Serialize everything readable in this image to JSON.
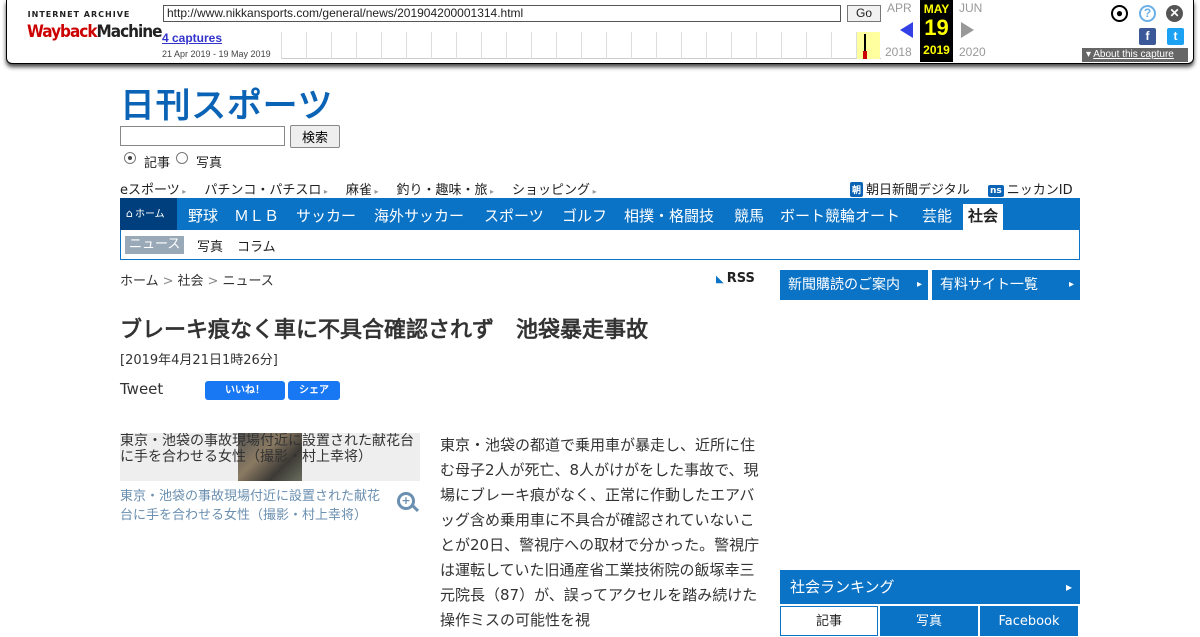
{
  "wayback": {
    "logo_top": "INTERNET ARCHIVE",
    "logo_way": "Wayback",
    "logo_machine": "Machine",
    "url": "http://www.nikkansports.com/general/news/201904200001314.html",
    "go_label": "Go",
    "captures": "4 captures",
    "range": "21 Apr 2019 - 19 May 2019",
    "prev_month": "APR",
    "cur_month": "MAY",
    "next_month": "JUN",
    "cur_day": "19",
    "prev_year": "2018",
    "cur_year": "2019",
    "next_year": "2020",
    "about": "About this capture",
    "icons": [
      "user-icon",
      "help-icon",
      "close-icon",
      "facebook-icon",
      "twitter-icon"
    ]
  },
  "site": {
    "logo": "日刊スポーツ",
    "search_button": "検索",
    "radio_article": "記事",
    "radio_photo": "写真",
    "top_links": [
      "eスポーツ",
      "パチンコ・パチスロ",
      "麻雀",
      "釣り・趣味・旅",
      "ショッピング"
    ],
    "ext_asahi_badge": "朝",
    "ext_asahi": "朝日新聞デジタル",
    "ext_nikkan_badge": "ns",
    "ext_nikkan": "ニッカンID",
    "nav_home": "ホーム",
    "nav": [
      "野球",
      "ＭＬＢ",
      "サッカー",
      "海外サッカー",
      "スポーツ",
      "ゴルフ",
      "相撲・格闘技",
      "競馬",
      "ボート競輪オート",
      "芸能",
      "社会"
    ],
    "subnav": [
      "ニュース",
      "写真",
      "コラム"
    ],
    "accent": "#0b73c6"
  },
  "article": {
    "breadcrumb": [
      "ホーム",
      "社会",
      "ニュース"
    ],
    "crumb_sep": ">",
    "rss": "RSS",
    "title": "ブレーキ痕なく車に不具合確認されず　池袋暴走事故",
    "date": "[2019年4月21日1時26分]",
    "tweet": "Tweet",
    "fb_like": "いいね！",
    "fb_share": "シェア",
    "photo_alt": "東京・池袋の事故現場付近に設置された献花台に手を合わせる女性（撮影・村上幸将）",
    "caption": "東京・池袋の事故現場付近に設置された献花台に手を合わせる女性（撮影・村上幸将）",
    "body": "東京・池袋の都道で乗用車が暴走し、近所に住む母子2人が死亡、8人がけがをした事故で、現場にブレーキ痕がなく、正常に作動したエアバッグ含め乗用車に不具合が確認されていないことが20日、警視庁への取材で分かった。警視庁は運転していた旧通産省工業技術院の飯塚幸三元院長（87）が、誤ってアクセルを踏み続けた操作ミスの可能性を視"
  },
  "sidebar": {
    "subscribe": "新聞購読のご案内",
    "paid_sites": "有料サイト一覧",
    "ranking_title": "社会ランキング",
    "ranking_tabs": [
      "記事",
      "写真",
      "Facebook"
    ]
  }
}
